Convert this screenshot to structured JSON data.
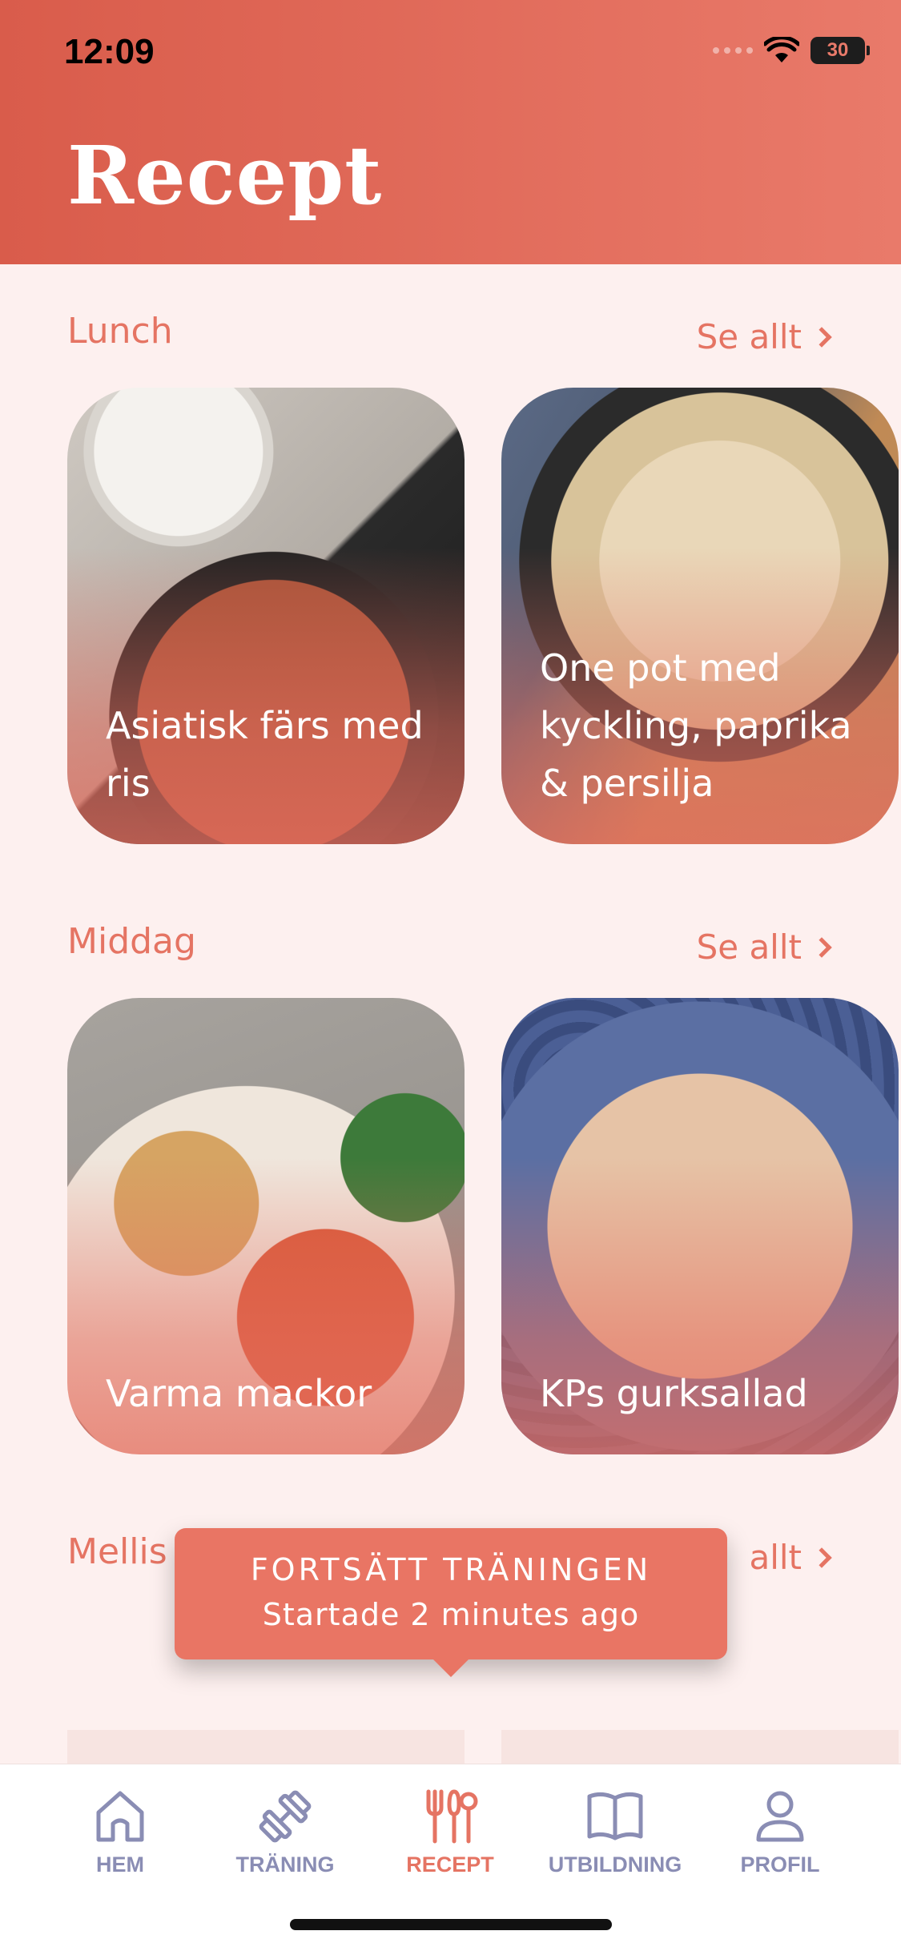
{
  "status": {
    "time": "12:09",
    "battery": "30"
  },
  "header": {
    "title": "Recept"
  },
  "sections": [
    {
      "title": "Lunch",
      "see_all": "Se allt",
      "cards": [
        {
          "title": "Asiatisk färs med ris"
        },
        {
          "title": "One pot med kyckling, paprika & persilja"
        }
      ]
    },
    {
      "title": "Middag",
      "see_all": "Se allt",
      "cards": [
        {
          "title": "Varma mackor"
        },
        {
          "title": "KPs gurksallad"
        }
      ]
    },
    {
      "title": "Mellis",
      "see_all": "allt"
    }
  ],
  "toast": {
    "title": "FORTSÄTT TRÄNINGEN",
    "subtitle": "Startade 2 minutes ago"
  },
  "tabs": [
    {
      "label": "HEM",
      "icon": "home-icon"
    },
    {
      "label": "TRÄNING",
      "icon": "dumbbell-icon"
    },
    {
      "label": "RECEPT",
      "icon": "utensils-icon",
      "active": true
    },
    {
      "label": "UTBILDNING",
      "icon": "book-icon"
    },
    {
      "label": "PROFIL",
      "icon": "person-icon"
    }
  ],
  "colors": {
    "accent": "#e57463",
    "header": "#d95c4b",
    "tab_inactive": "#8a8db4",
    "background": "#fdf0ef"
  }
}
